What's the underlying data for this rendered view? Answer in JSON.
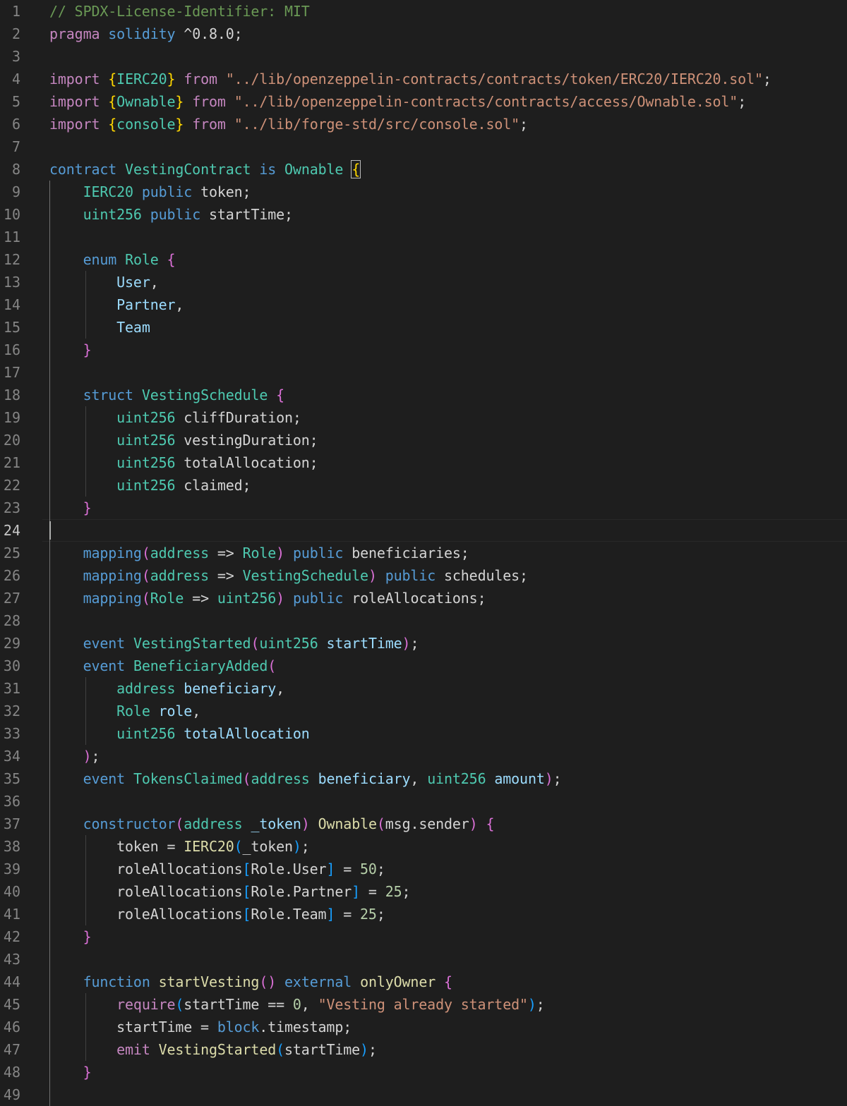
{
  "editor": {
    "active_line": 24,
    "colors": {
      "background": "#1e1e1e",
      "comment": "#6a9955",
      "keyword": "#569cd6",
      "control": "#c586c0",
      "type": "#4ec9b0",
      "function": "#dcdcaa",
      "string": "#ce9178",
      "number": "#b5cea8",
      "variable": "#9cdcfe",
      "bracket_1": "#ffd700",
      "bracket_2": "#da70d6",
      "bracket_3": "#179fff"
    },
    "lines": [
      [
        [
          "// SPDX-License-Identifier: MIT",
          "comment"
        ]
      ],
      [
        [
          "pragma",
          "ctrl"
        ],
        [
          " "
        ],
        [
          "solidity",
          "kw"
        ],
        [
          " ^0.8.0;"
        ]
      ],
      [],
      [
        [
          "import",
          "ctrl"
        ],
        [
          " "
        ],
        [
          "{",
          "b1"
        ],
        [
          "IERC20",
          "type"
        ],
        [
          "}",
          "b1"
        ],
        [
          " "
        ],
        [
          "from",
          "ctrl"
        ],
        [
          " "
        ],
        [
          "\"../lib/openzeppelin-contracts/contracts/token/ERC20/IERC20.sol\"",
          "str"
        ],
        [
          ";"
        ]
      ],
      [
        [
          "import",
          "ctrl"
        ],
        [
          " "
        ],
        [
          "{",
          "b1"
        ],
        [
          "Ownable",
          "type"
        ],
        [
          "}",
          "b1"
        ],
        [
          " "
        ],
        [
          "from",
          "ctrl"
        ],
        [
          " "
        ],
        [
          "\"../lib/openzeppelin-contracts/contracts/access/Ownable.sol\"",
          "str"
        ],
        [
          ";"
        ]
      ],
      [
        [
          "import",
          "ctrl"
        ],
        [
          " "
        ],
        [
          "{",
          "b1"
        ],
        [
          "console",
          "type"
        ],
        [
          "}",
          "b1"
        ],
        [
          " "
        ],
        [
          "from",
          "ctrl"
        ],
        [
          " "
        ],
        [
          "\"../lib/forge-std/src/console.sol\"",
          "str"
        ],
        [
          ";"
        ]
      ],
      [],
      [
        [
          "contract",
          "kw"
        ],
        [
          " "
        ],
        [
          "VestingContract",
          "type"
        ],
        [
          " "
        ],
        [
          "is",
          "kw"
        ],
        [
          " "
        ],
        [
          "Ownable",
          "type"
        ],
        [
          " "
        ],
        [
          "{",
          "b1"
        ]
      ],
      [
        [
          "    "
        ],
        [
          "IERC20",
          "type"
        ],
        [
          " "
        ],
        [
          "public",
          "kw"
        ],
        [
          " token;"
        ]
      ],
      [
        [
          "    "
        ],
        [
          "uint256",
          "type"
        ],
        [
          " "
        ],
        [
          "public",
          "kw"
        ],
        [
          " startTime;"
        ]
      ],
      [],
      [
        [
          "    "
        ],
        [
          "enum",
          "kw"
        ],
        [
          " "
        ],
        [
          "Role",
          "type"
        ],
        [
          " "
        ],
        [
          "{",
          "b2"
        ]
      ],
      [
        [
          "        "
        ],
        [
          "User",
          "var"
        ],
        [
          ","
        ]
      ],
      [
        [
          "        "
        ],
        [
          "Partner",
          "var"
        ],
        [
          ","
        ]
      ],
      [
        [
          "        "
        ],
        [
          "Team",
          "var"
        ]
      ],
      [
        [
          "    "
        ],
        [
          "}",
          "b2"
        ]
      ],
      [],
      [
        [
          "    "
        ],
        [
          "struct",
          "kw"
        ],
        [
          " "
        ],
        [
          "VestingSchedule",
          "type"
        ],
        [
          " "
        ],
        [
          "{",
          "b2"
        ]
      ],
      [
        [
          "        "
        ],
        [
          "uint256",
          "type"
        ],
        [
          " cliffDuration;"
        ]
      ],
      [
        [
          "        "
        ],
        [
          "uint256",
          "type"
        ],
        [
          " vestingDuration;"
        ]
      ],
      [
        [
          "        "
        ],
        [
          "uint256",
          "type"
        ],
        [
          " totalAllocation;"
        ]
      ],
      [
        [
          "        "
        ],
        [
          "uint256",
          "type"
        ],
        [
          " claimed;"
        ]
      ],
      [
        [
          "    "
        ],
        [
          "}",
          "b2"
        ]
      ],
      [],
      [
        [
          "    "
        ],
        [
          "mapping",
          "kw"
        ],
        [
          "(",
          "b2"
        ],
        [
          "address",
          "type"
        ],
        [
          " => "
        ],
        [
          "Role",
          "type"
        ],
        [
          ")",
          "b2"
        ],
        [
          " "
        ],
        [
          "public",
          "kw"
        ],
        [
          " beneficiaries;"
        ]
      ],
      [
        [
          "    "
        ],
        [
          "mapping",
          "kw"
        ],
        [
          "(",
          "b2"
        ],
        [
          "address",
          "type"
        ],
        [
          " => "
        ],
        [
          "VestingSchedule",
          "type"
        ],
        [
          ")",
          "b2"
        ],
        [
          " "
        ],
        [
          "public",
          "kw"
        ],
        [
          " schedules;"
        ]
      ],
      [
        [
          "    "
        ],
        [
          "mapping",
          "kw"
        ],
        [
          "(",
          "b2"
        ],
        [
          "Role",
          "type"
        ],
        [
          " => "
        ],
        [
          "uint256",
          "type"
        ],
        [
          ")",
          "b2"
        ],
        [
          " "
        ],
        [
          "public",
          "kw"
        ],
        [
          " roleAllocations;"
        ]
      ],
      [],
      [
        [
          "    "
        ],
        [
          "event",
          "kw"
        ],
        [
          " "
        ],
        [
          "VestingStarted",
          "type"
        ],
        [
          "(",
          "b2"
        ],
        [
          "uint256",
          "type"
        ],
        [
          " "
        ],
        [
          "startTime",
          "var"
        ],
        [
          ")",
          "b2"
        ],
        [
          ";"
        ]
      ],
      [
        [
          "    "
        ],
        [
          "event",
          "kw"
        ],
        [
          " "
        ],
        [
          "BeneficiaryAdded",
          "type"
        ],
        [
          "(",
          "b2"
        ]
      ],
      [
        [
          "        "
        ],
        [
          "address",
          "type"
        ],
        [
          " "
        ],
        [
          "beneficiary",
          "var"
        ],
        [
          ","
        ]
      ],
      [
        [
          "        "
        ],
        [
          "Role",
          "type"
        ],
        [
          " "
        ],
        [
          "role",
          "var"
        ],
        [
          ","
        ]
      ],
      [
        [
          "        "
        ],
        [
          "uint256",
          "type"
        ],
        [
          " "
        ],
        [
          "totalAllocation",
          "var"
        ]
      ],
      [
        [
          "    "
        ],
        [
          ")",
          "b2"
        ],
        [
          ";"
        ]
      ],
      [
        [
          "    "
        ],
        [
          "event",
          "kw"
        ],
        [
          " "
        ],
        [
          "TokensClaimed",
          "type"
        ],
        [
          "(",
          "b2"
        ],
        [
          "address",
          "type"
        ],
        [
          " "
        ],
        [
          "beneficiary",
          "var"
        ],
        [
          ", "
        ],
        [
          "uint256",
          "type"
        ],
        [
          " "
        ],
        [
          "amount",
          "var"
        ],
        [
          ")",
          "b2"
        ],
        [
          ";"
        ]
      ],
      [],
      [
        [
          "    "
        ],
        [
          "constructor",
          "kw"
        ],
        [
          "(",
          "b2"
        ],
        [
          "address",
          "type"
        ],
        [
          " "
        ],
        [
          "_token",
          "var"
        ],
        [
          ")",
          "b2"
        ],
        [
          " "
        ],
        [
          "Ownable",
          "func"
        ],
        [
          "(",
          "b2"
        ],
        [
          "msg.sender"
        ],
        [
          ")",
          "b2"
        ],
        [
          " "
        ],
        [
          "{",
          "b2"
        ]
      ],
      [
        [
          "        token = "
        ],
        [
          "IERC20",
          "func"
        ],
        [
          "(",
          "b3"
        ],
        [
          "_token"
        ],
        [
          ")",
          "b3"
        ],
        [
          ";"
        ]
      ],
      [
        [
          "        roleAllocations"
        ],
        [
          "[",
          "b3"
        ],
        [
          "Role.User"
        ],
        [
          "]",
          "b3"
        ],
        [
          " = "
        ],
        [
          "50",
          "num"
        ],
        [
          ";"
        ]
      ],
      [
        [
          "        roleAllocations"
        ],
        [
          "[",
          "b3"
        ],
        [
          "Role.Partner"
        ],
        [
          "]",
          "b3"
        ],
        [
          " = "
        ],
        [
          "25",
          "num"
        ],
        [
          ";"
        ]
      ],
      [
        [
          "        roleAllocations"
        ],
        [
          "[",
          "b3"
        ],
        [
          "Role.Team"
        ],
        [
          "]",
          "b3"
        ],
        [
          " = "
        ],
        [
          "25",
          "num"
        ],
        [
          ";"
        ]
      ],
      [
        [
          "    "
        ],
        [
          "}",
          "b2"
        ]
      ],
      [],
      [
        [
          "    "
        ],
        [
          "function",
          "kw"
        ],
        [
          " "
        ],
        [
          "startVesting",
          "func"
        ],
        [
          "()",
          "b2"
        ],
        [
          " "
        ],
        [
          "external",
          "kw"
        ],
        [
          " "
        ],
        [
          "onlyOwner",
          "func"
        ],
        [
          " "
        ],
        [
          "{",
          "b2"
        ]
      ],
      [
        [
          "        "
        ],
        [
          "require",
          "ctrl"
        ],
        [
          "(",
          "b3"
        ],
        [
          "startTime == "
        ],
        [
          "0",
          "num"
        ],
        [
          ", "
        ],
        [
          "\"Vesting already started\"",
          "str"
        ],
        [
          ")",
          "b3"
        ],
        [
          ";"
        ]
      ],
      [
        [
          "        startTime = "
        ],
        [
          "block",
          "kw"
        ],
        [
          ".timestamp;"
        ]
      ],
      [
        [
          "        "
        ],
        [
          "emit",
          "ctrl"
        ],
        [
          " "
        ],
        [
          "VestingStarted",
          "func"
        ],
        [
          "(",
          "b3"
        ],
        [
          "startTime"
        ],
        [
          ")",
          "b3"
        ],
        [
          ";"
        ]
      ],
      [
        [
          "    "
        ],
        [
          "}",
          "b2"
        ]
      ],
      []
    ]
  }
}
